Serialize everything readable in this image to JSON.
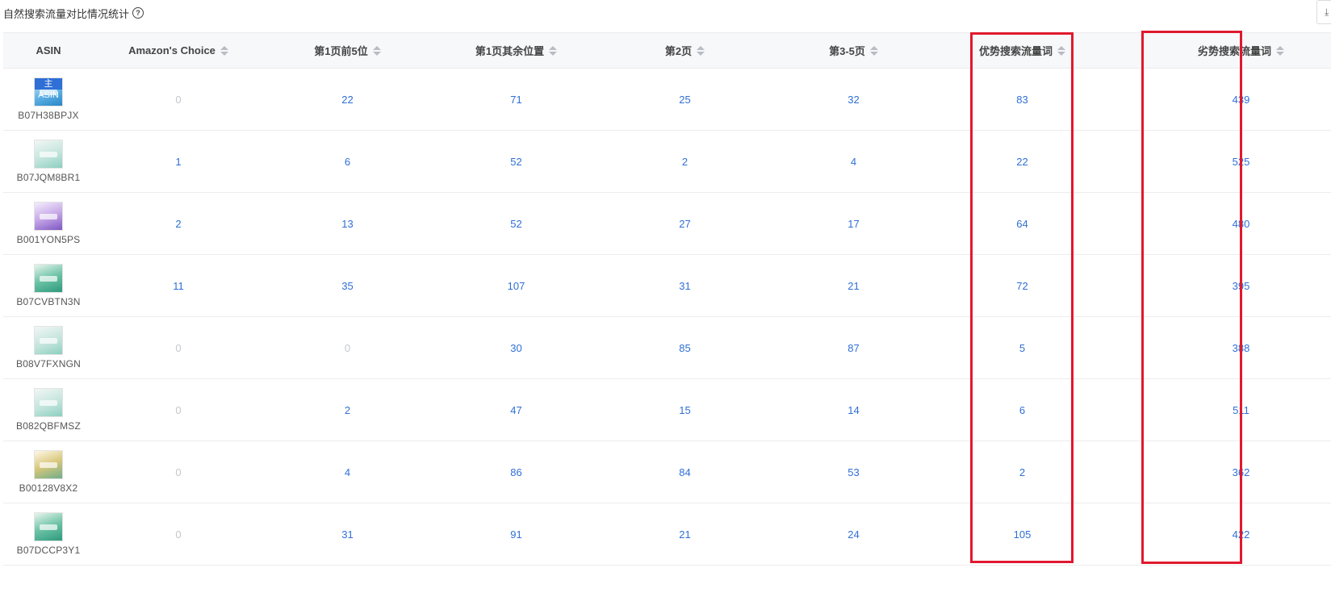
{
  "header": {
    "title": "自然搜索流量对比情况统计",
    "help_icon": "question-circle-icon",
    "download_icon": "download-icon",
    "download_glyph": "⤓"
  },
  "table": {
    "columns": [
      {
        "key": "asin",
        "label": "ASIN",
        "sortable": false
      },
      {
        "key": "choice",
        "label": "Amazon's Choice",
        "sortable": true
      },
      {
        "key": "p1top5",
        "label": "第1页前5位",
        "sortable": true
      },
      {
        "key": "p1other",
        "label": "第1页其余位置",
        "sortable": true
      },
      {
        "key": "p2",
        "label": "第2页",
        "sortable": true
      },
      {
        "key": "p3",
        "label": "第3-5页",
        "sortable": true
      },
      {
        "key": "adv",
        "label": "优势搜索流量词",
        "sortable": true
      },
      {
        "key": "dis",
        "label": "劣势搜索流量词",
        "sortable": true
      }
    ],
    "main_badge": "主ASIN",
    "rows": [
      {
        "asin": "B07H38BPJX",
        "main": true,
        "choice": "0",
        "p1top5": "22",
        "p1other": "71",
        "p2": "25",
        "p3": "32",
        "adv": "83",
        "dis": "439"
      },
      {
        "asin": "B07JQM8BR1",
        "main": false,
        "choice": "1",
        "p1top5": "6",
        "p1other": "52",
        "p2": "2",
        "p3": "4",
        "adv": "22",
        "dis": "525"
      },
      {
        "asin": "B001YON5PS",
        "main": false,
        "choice": "2",
        "p1top5": "13",
        "p1other": "52",
        "p2": "27",
        "p3": "17",
        "adv": "64",
        "dis": "480"
      },
      {
        "asin": "B07CVBTN3N",
        "main": false,
        "choice": "11",
        "p1top5": "35",
        "p1other": "107",
        "p2": "31",
        "p3": "21",
        "adv": "72",
        "dis": "395"
      },
      {
        "asin": "B08V7FXNGN",
        "main": false,
        "choice": "0",
        "p1top5": "0",
        "p1other": "30",
        "p2": "85",
        "p3": "87",
        "adv": "5",
        "dis": "388"
      },
      {
        "asin": "B082QBFMSZ",
        "main": false,
        "choice": "0",
        "p1top5": "2",
        "p1other": "47",
        "p2": "15",
        "p3": "14",
        "adv": "6",
        "dis": "511"
      },
      {
        "asin": "B00128V8X2",
        "main": false,
        "choice": "0",
        "p1top5": "4",
        "p1other": "86",
        "p2": "84",
        "p3": "53",
        "adv": "2",
        "dis": "362"
      },
      {
        "asin": "B07DCCP3Y1",
        "main": false,
        "choice": "0",
        "p1top5": "31",
        "p1other": "91",
        "p2": "21",
        "p3": "24",
        "adv": "105",
        "dis": "422"
      }
    ]
  },
  "colors": {
    "link": "#2f6fd6",
    "zero": "#c4c7cc",
    "highlight": "#e0192e",
    "header_bg": "#f7f8fa"
  }
}
